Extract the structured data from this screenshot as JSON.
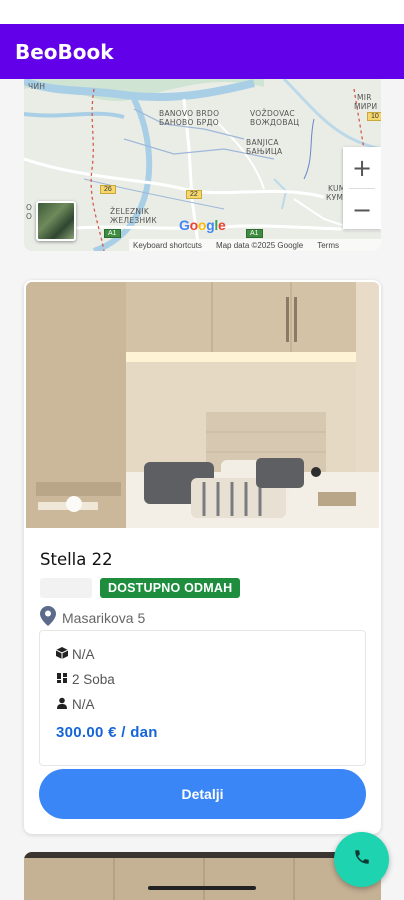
{
  "app": {
    "title": "BeoBook"
  },
  "map": {
    "labels": {
      "top_left": "ЧИН",
      "banovo_brdo_lat": "BANOVO BRDO",
      "banovo_brdo_cyr": "БАНОВО БРДО",
      "vozdovac_lat": "VOŽDOVAC",
      "vozdovac_cyr": "ВОЖДОВАЦ",
      "banjica_lat": "BANJICA",
      "banjica_cyr": "БАЊИЦА",
      "mirijevo_lat": "MIR",
      "mirijevo_cyr": "МИРИ",
      "kumodraz_lat": "KUMO",
      "kumodraz_cyr": "КУМОД",
      "zeleznik_lat": "ŽELEZNIK",
      "zeleznik_cyr": "ЖЕЛЕЗНИК",
      "left_edge_lat": "O",
      "left_edge_cyr": "О"
    },
    "road_shields": [
      "26",
      "22",
      "A1",
      "A1",
      "10"
    ],
    "zoom_in": "+",
    "zoom_out": "−",
    "google_logo": "Google",
    "footer": {
      "shortcuts": "Keyboard shortcuts",
      "data": "Map data ©2025 Google",
      "terms": "Terms"
    }
  },
  "listing": {
    "title": "Stella 22",
    "badge": "DOSTUPNO ODMAH",
    "address": "Masarikova 5",
    "size": "N/A",
    "rooms": "2 Soba",
    "guests": "N/A",
    "price": "300.00 € / dan",
    "button": "Detalji"
  },
  "colors": {
    "app_bar": "#6200ea",
    "badge": "#1e8e3e",
    "price": "#1565d8",
    "button": "#3a86f7",
    "fab": "#1dd3b0"
  },
  "icons": {
    "location": "map-pin-icon",
    "size": "cube-icon",
    "rooms": "rooms-icon",
    "guests": "person-icon",
    "fab": "phone-icon"
  }
}
